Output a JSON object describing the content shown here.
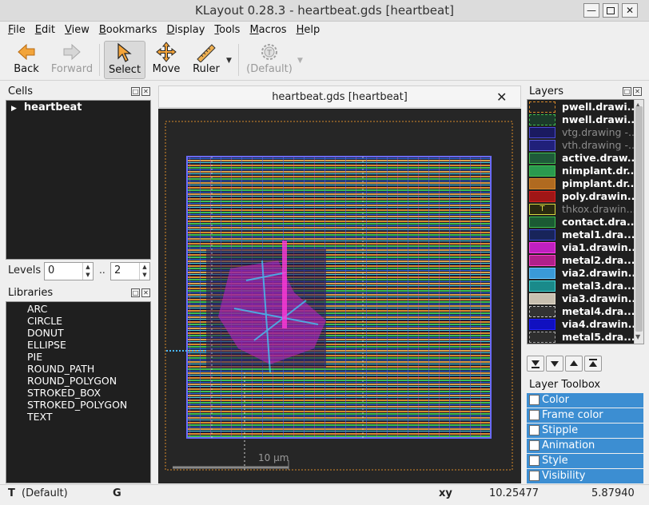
{
  "window": {
    "title": "KLayout 0.28.3 - heartbeat.gds [heartbeat]"
  },
  "menu": [
    {
      "label": "File",
      "mn": "F",
      "rest": "ile"
    },
    {
      "label": "Edit",
      "mn": "E",
      "rest": "dit"
    },
    {
      "label": "View",
      "mn": "V",
      "rest": "iew"
    },
    {
      "label": "Bookmarks",
      "mn": "B",
      "rest": "ookmarks"
    },
    {
      "label": "Display",
      "mn": "D",
      "rest": "isplay"
    },
    {
      "label": "Tools",
      "mn": "T",
      "rest": "ools"
    },
    {
      "label": "Macros",
      "mn": "M",
      "rest": "acros"
    },
    {
      "label": "Help",
      "mn": "H",
      "rest": "elp"
    }
  ],
  "toolbar": {
    "back": "Back",
    "forward": "Forward",
    "select": "Select",
    "move": "Move",
    "ruler": "Ruler",
    "default": "(Default)"
  },
  "cells": {
    "title": "Cells",
    "items": [
      "heartbeat"
    ]
  },
  "levels": {
    "label": "Levels",
    "from": "0",
    "sep": "..",
    "to": "2"
  },
  "libraries": {
    "title": "Libraries",
    "items": [
      "ARC",
      "CIRCLE",
      "DONUT",
      "ELLIPSE",
      "PIE",
      "ROUND_PATH",
      "ROUND_POLYGON",
      "STROKED_BOX",
      "STROKED_POLYGON",
      "TEXT"
    ]
  },
  "view": {
    "tab_title": "heartbeat.gds [heartbeat]",
    "scale_label": "10  µm"
  },
  "layers": {
    "title": "Layers",
    "items": [
      {
        "name": "pwell.drawi...",
        "color": "#2a2a2a",
        "dim": false
      },
      {
        "name": "nwell.drawi...",
        "color": "#1f5f3f",
        "dim": false
      },
      {
        "name": "vtg.drawing -...",
        "color": "#1a1a70",
        "dim": true
      },
      {
        "name": "vth.drawing -...",
        "color": "#22228a",
        "dim": true
      },
      {
        "name": "active.draw...",
        "color": "#1f8a4f",
        "dim": false
      },
      {
        "name": "nimplant.dr...",
        "color": "#22aa55",
        "dim": false
      },
      {
        "name": "pimplant.dr...",
        "color": "#d07a20",
        "dim": false
      },
      {
        "name": "poly.drawin...",
        "color": "#b01818",
        "dim": false
      },
      {
        "name": "thkox.drawin...",
        "color": "#d0d040",
        "dim": true
      },
      {
        "name": "contact.dra...",
        "color": "#1b6e3a",
        "dim": false
      },
      {
        "name": "metal1.dra...",
        "color": "#1a2a7a",
        "dim": false
      },
      {
        "name": "via1.drawin...",
        "color": "#d020c8",
        "dim": false
      },
      {
        "name": "metal2.dra...",
        "color": "#d028a8",
        "dim": false
      },
      {
        "name": "via2.drawin...",
        "color": "#3aa0d8",
        "dim": false
      },
      {
        "name": "metal3.dra...",
        "color": "#2abcbc",
        "dim": false
      },
      {
        "name": "via3.drawin...",
        "color": "#d8d0c0",
        "dim": false
      },
      {
        "name": "metal4.dra...",
        "color": "#444444",
        "dim": false
      },
      {
        "name": "via4.drawin...",
        "color": "#1010c8",
        "dim": false
      },
      {
        "name": "metal5.dra...",
        "color": "#3a3a3a",
        "dim": false
      }
    ]
  },
  "toolbox": {
    "title": "Layer Toolbox",
    "items": [
      "Color",
      "Frame color",
      "Stipple",
      "Animation",
      "Style",
      "Visibility"
    ]
  },
  "status": {
    "mode": "T",
    "default": "(Default)",
    "g": "G",
    "xy_label": "xy",
    "x": "10.25477",
    "y": "5.87940"
  }
}
